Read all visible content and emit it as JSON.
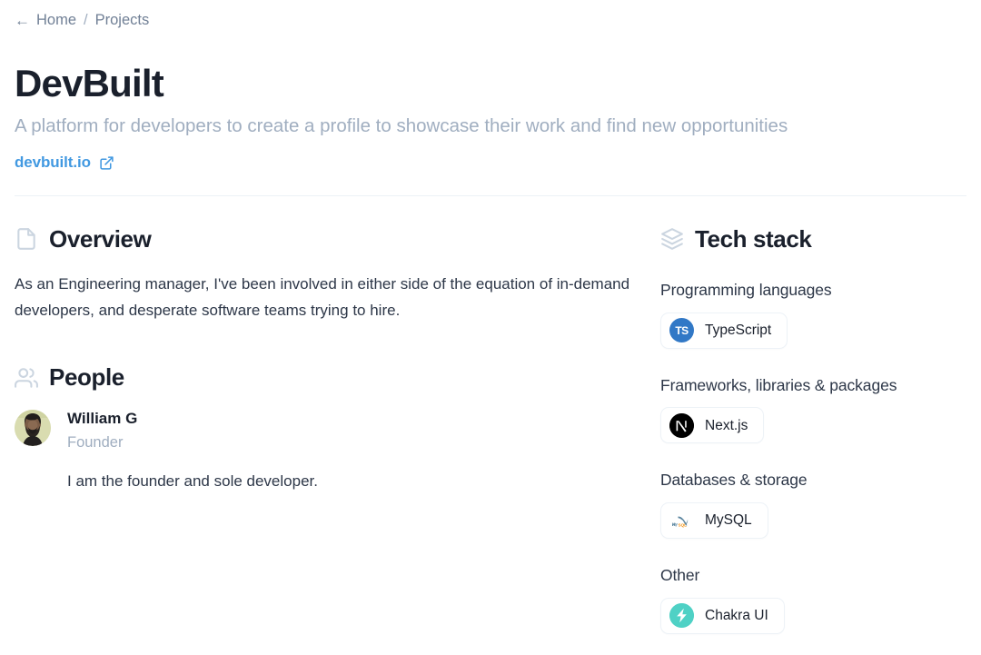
{
  "breadcrumb": {
    "back_arrow": "←",
    "home_label": "Home",
    "separator": "/",
    "current_label": "Projects"
  },
  "header": {
    "title": "DevBuilt",
    "subtitle": "A platform for developers to create a profile to showcase their work and find new opportunities",
    "site_link_text": "devbuilt.io",
    "link_color": "#4299e1"
  },
  "overview": {
    "heading": "Overview",
    "text": "As an Engineering manager, I've been involved in either side of the equation of in-demand developers, and desperate software teams trying to hire."
  },
  "people": {
    "heading": "People",
    "members": [
      {
        "name": "William G",
        "role": "Founder",
        "note": "I am the founder and sole developer."
      }
    ]
  },
  "tech_stack": {
    "heading": "Tech stack",
    "groups": [
      {
        "label": "Programming languages",
        "items": [
          {
            "name": "TypeScript",
            "logo": "typescript-logo",
            "color": "#3178c6"
          }
        ]
      },
      {
        "label": "Frameworks, libraries & packages",
        "items": [
          {
            "name": "Next.js",
            "logo": "nextjs-logo",
            "color": "#000000"
          }
        ]
      },
      {
        "label": "Databases & storage",
        "items": [
          {
            "name": "MySQL",
            "logo": "mysql-logo",
            "color": "#00758f"
          }
        ]
      },
      {
        "label": "Other",
        "items": [
          {
            "name": "Chakra UI",
            "logo": "chakra-ui-logo",
            "color": "#4fd1c5"
          }
        ]
      }
    ]
  }
}
